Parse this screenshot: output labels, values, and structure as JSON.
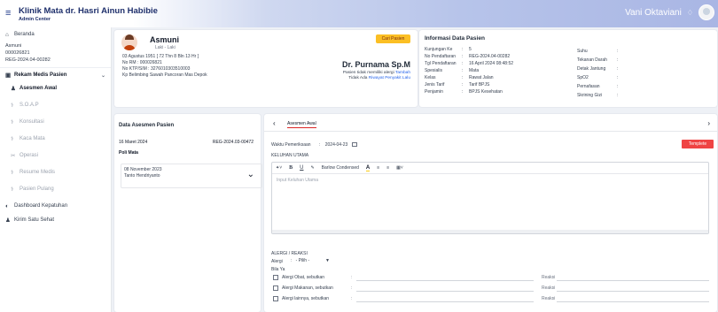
{
  "header": {
    "title": "Klinik Mata dr. Hasri Ainun Habibie",
    "subtitle": "Admin Center",
    "user_name": "Vani Oktaviani",
    "menu_icon": "hamburger-icon",
    "bell_icon": "bell-icon"
  },
  "sidebar": {
    "beranda": "Beranda",
    "patient": {
      "name": "Asmuni",
      "id": "000026821",
      "reg": "REG-2024.04-00282"
    },
    "rekam_medis": "Rekam Medis Pasien",
    "items": [
      {
        "label": "Asesmen Awal",
        "icon": "user-icon",
        "active": true
      },
      {
        "label": "S.O.A.P",
        "icon": "stethoscope-icon",
        "active": false
      },
      {
        "label": "Konsultasi",
        "icon": "stethoscope-icon",
        "active": false
      },
      {
        "label": "Kaca Mata",
        "icon": "stethoscope-icon",
        "active": false
      },
      {
        "label": "Operasi",
        "icon": "operation-icon",
        "active": false
      },
      {
        "label": "Resume Medis",
        "icon": "stethoscope-icon",
        "active": false
      },
      {
        "label": "Pasien Pulang",
        "icon": "stethoscope-icon",
        "active": false
      }
    ],
    "dashboard": "Dashboard Kepatuhan",
    "satusehat": "Kirim Satu Sehat"
  },
  "patient_card": {
    "name": "Asmuni",
    "gender": "Laki - Laki",
    "dob": "03 Agustus 1951 [ 72 Thn 8 Bln 13 Hr ]",
    "rm": "No RM : 000026821",
    "ktp": "No KTP/SIM : 3276010303510003",
    "address": "Kp Belimbing Sawah Pancoran Mas Depok",
    "btn_cari": "Cari Pasien",
    "doctor": "Dr. Purnama Sp.M",
    "allergy_text": "Pasien tidak memiliki alergi",
    "allergy_link": "Tambah",
    "history_text": "Tidak Ada",
    "history_link": "Riwayat Penyakit Lalu"
  },
  "info": {
    "title": "Informasi Data Pasien",
    "left": [
      {
        "k": "Kunjungan Ke",
        "v": "5"
      },
      {
        "k": "No Pendaftaran",
        "v": "REG-2024.04-00282"
      },
      {
        "k": "Tgl Pendaftaran",
        "v": "16 April 2024 08:48:52"
      },
      {
        "k": "Spesialis",
        "v": "Mata"
      },
      {
        "k": "Kelas",
        "v": "Rawat Jalan"
      },
      {
        "k": "Jenis Tarif",
        "v": "Tarif BPJS"
      },
      {
        "k": "Penjamin",
        "v": "BPJS Kesehatan"
      }
    ],
    "right": [
      {
        "k": "Suhu",
        "v": ""
      },
      {
        "k": "Tekanan Darah",
        "v": ""
      },
      {
        "k": "Detak Jantung",
        "v": ""
      },
      {
        "k": "SpO2",
        "v": ""
      },
      {
        "k": "Pernafasan",
        "v": ""
      },
      {
        "k": "Skrining Gizi",
        "v": ""
      }
    ]
  },
  "data_asesmen": {
    "title": "Data Asesmen Pasien",
    "date": "16 Maret 2024",
    "reg": "REG-2024.03-00472",
    "poli": "Poli Mata",
    "item_date": "08 November 2023",
    "item_name": "Tanto Hendriyanto"
  },
  "form": {
    "tab": "Asesmen Awal",
    "waktu_label": "Waktu Pemeriksaan",
    "waktu_value": "2024-04-23",
    "templete": "Templete",
    "keluhan_label": "KELUHAN UTAMA",
    "font_name": "Barlow Condensed",
    "placeholder": "Input Keluhan Utama",
    "alergi_title": "ALERGI / REAKSI",
    "alergi_label": "Alergi",
    "pilih": "- Pilih -",
    "bila_ya": "Bila Ya",
    "reaksi": "Reaksi",
    "rows": [
      {
        "label": "Alergi Obat, sebutkan"
      },
      {
        "label": "Alergi Makanan, sebutkan"
      },
      {
        "label": "Alergi lainnya, sebutkan"
      }
    ]
  },
  "colors": {
    "accent": "#ef4444",
    "warning": "#fbbf24",
    "brand": "#1e2f6b",
    "link": "#2563eb"
  }
}
